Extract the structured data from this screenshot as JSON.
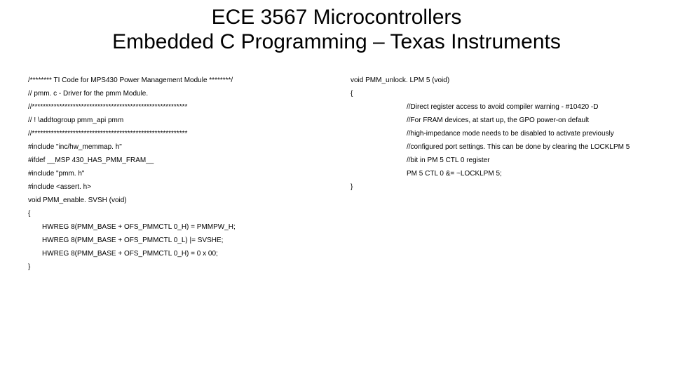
{
  "title_line1": "ECE 3567 Microcontrollers",
  "title_line2": "Embedded C Programming – Texas Instruments",
  "left": {
    "l0": "/******** TI Code for MPS430 Power Management Module ********/",
    "l1": "// pmm. c - Driver for the pmm Module.",
    "l2": "//*********************************************************",
    "l3": "// ! \\addtogroup pmm_api pmm",
    "l4": "//*********************************************************",
    "l5": "#include \"inc/hw_memmap. h\"",
    "l6": "#ifdef __MSP 430_HAS_PMM_FRAM__",
    "l7": "#include \"pmm. h\"",
    "l8": "#include <assert. h>",
    "l9": "void PMM_enable. SVSH (void)",
    "l10": "{",
    "l11": "HWREG 8(PMM_BASE + OFS_PMMCTL 0_H) = PMMPW_H;",
    "l12": "HWREG 8(PMM_BASE + OFS_PMMCTL 0_L) |= SVSHE;",
    "l13": "HWREG 8(PMM_BASE + OFS_PMMCTL 0_H) = 0 x 00;",
    "l14": "}"
  },
  "right": {
    "r0": "void PMM_unlock. LPM 5 (void)",
    "r1": "{",
    "r2": "//Direct register access to avoid compiler warning - #10420 -D",
    "r3": "//For FRAM devices, at start up, the GPO power-on default",
    "r4": "//high-impedance mode needs to be disabled to activate previously",
    "r5": "//configured port settings. This can be done by clearing the LOCKLPM 5",
    "r6": "//bit in PM 5 CTL 0 register",
    "r7": "PM 5 CTL 0 &= ~LOCKLPM 5;",
    "r8": "}"
  }
}
